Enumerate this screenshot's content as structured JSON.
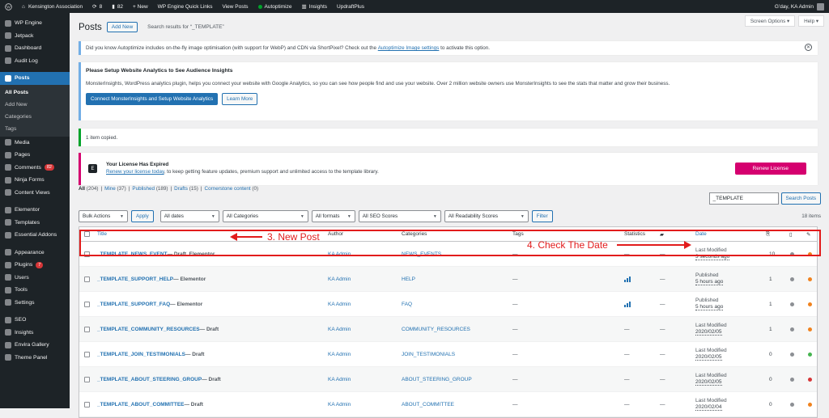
{
  "admin_bar": {
    "site_name": "Kensington Association",
    "updates_count": "8",
    "comments_count": "82",
    "new_label": "+ New",
    "items": [
      "WP Engine Quick Links",
      "View Posts",
      "Autoptimize",
      "Insights",
      "UpdraftPlus"
    ],
    "greeting": "G'day, KA Admin"
  },
  "sidebar": {
    "items_top": [
      {
        "label": "WP Engine",
        "icon": "wp-engine-icon"
      },
      {
        "label": "Jetpack",
        "icon": "jetpack-icon"
      },
      {
        "label": "Dashboard",
        "icon": "dashboard-icon"
      },
      {
        "label": "Audit Log",
        "icon": "audit-log-icon"
      }
    ],
    "posts": {
      "label": "Posts",
      "icon": "posts-icon"
    },
    "submenu": [
      "All Posts",
      "Add New",
      "Categories",
      "Tags"
    ],
    "items_mid": [
      {
        "label": "Media",
        "icon": "media-icon"
      },
      {
        "label": "Pages",
        "icon": "pages-icon"
      },
      {
        "label": "Comments",
        "icon": "comments-icon",
        "badge": "82"
      },
      {
        "label": "Ninja Forms",
        "icon": "ninja-forms-icon"
      },
      {
        "label": "Content Views",
        "icon": "content-views-icon"
      }
    ],
    "items_mid2": [
      {
        "label": "Elementor",
        "icon": "elementor-icon"
      },
      {
        "label": "Templates",
        "icon": "templates-icon"
      },
      {
        "label": "Essential Addons",
        "icon": "essential-addons-icon"
      }
    ],
    "items_low": [
      {
        "label": "Appearance",
        "icon": "appearance-icon"
      },
      {
        "label": "Plugins",
        "icon": "plugins-icon",
        "badge": "7"
      },
      {
        "label": "Users",
        "icon": "users-icon"
      },
      {
        "label": "Tools",
        "icon": "tools-icon"
      },
      {
        "label": "Settings",
        "icon": "settings-icon"
      }
    ],
    "items_bottom": [
      {
        "label": "SEO",
        "icon": "seo-icon"
      },
      {
        "label": "Insights",
        "icon": "insights-icon"
      },
      {
        "label": "Envira Gallery",
        "icon": "envira-gallery-icon"
      },
      {
        "label": "Theme Panel",
        "icon": "theme-panel-icon"
      }
    ]
  },
  "header": {
    "screen_options": "Screen Options ▾",
    "help": "Help ▾",
    "title": "Posts",
    "add_new": "Add New",
    "search_results": "Search results for “_TEMPLATE”"
  },
  "notices": {
    "autoptimize_text": "Did you know Autoptimize includes on-the-fly image optimisation (with support for WebP) and CDN via ShortPixel? Check out the",
    "autoptimize_link": "Autoptimize Image settings",
    "autoptimize_tail": "to activate this option.",
    "analytics_title": "Please Setup Website Analytics to See Audience Insights",
    "analytics_body": "MonsterInsights, WordPress analytics plugin, helps you connect your website with Google Analytics, so you can see how people find and use your website. Over 2 million website owners use MonsterInsights to see the stats that matter and grow their business.",
    "connect_button": "Connect MonsterInsights and Setup Website Analytics",
    "learn_more": "Learn More",
    "copied": "1 item copied.",
    "license_title": "Your License Has Expired",
    "license_link": "Renew your license today",
    "license_tail": ", to keep getting feature updates, premium support and unlimited access to the template library.",
    "renew_button": "Renew License"
  },
  "filters": {
    "views": [
      {
        "label": "All",
        "count": "(204)"
      },
      {
        "label": "Mine",
        "count": "(37)"
      },
      {
        "label": "Published",
        "count": "(189)"
      },
      {
        "label": "Drafts",
        "count": "(15)"
      },
      {
        "label": "Cornerstone content",
        "count": "(0)"
      }
    ],
    "search_value": "_TEMPLATE",
    "search_button": "Search Posts",
    "bulk_actions": "Bulk Actions",
    "apply": "Apply",
    "all_dates": "All dates",
    "all_categories": "All Categories",
    "all_formats": "All formats",
    "all_seo": "All SEO Scores",
    "all_readability": "All Readability Scores",
    "filter": "Filter",
    "items_count": "18 items"
  },
  "table": {
    "headers": {
      "title": "Title",
      "author": "Author",
      "categories": "Categories",
      "tags": "Tags",
      "statistics": "Statistics",
      "date": "Date"
    },
    "rows": [
      {
        "title": "_TEMPLATE_NEWS_EVENT",
        "state": " — Draft, Elementor",
        "author": "KA Admin",
        "category": "NEWS_EVENTS",
        "tags": "—",
        "stats": "—",
        "comments": "—",
        "date_label": "Last Modified",
        "date": "3 seconds ago",
        "count": "10",
        "dot1": "#8c8f94",
        "dot2": "#f0821e",
        "has_stats": false
      },
      {
        "title": "_TEMPLATE_SUPPORT_HELP",
        "state": " — Elementor",
        "author": "KA Admin",
        "category": "HELP",
        "tags": "—",
        "stats": "",
        "comments": "—",
        "date_label": "Published",
        "date": "5 hours ago",
        "count": "1",
        "dot1": "#8c8f94",
        "dot2": "#f0821e",
        "has_stats": true
      },
      {
        "title": "_TEMPLATE_SUPPORT_FAQ",
        "state": " — Elementor",
        "author": "KA Admin",
        "category": "FAQ",
        "tags": "—",
        "stats": "",
        "comments": "—",
        "date_label": "Published",
        "date": "5 hours ago",
        "count": "1",
        "dot1": "#8c8f94",
        "dot2": "#f0821e",
        "has_stats": true
      },
      {
        "title": "_TEMPLATE_COMMUNITY_RESOURCES",
        "state": " — Draft",
        "author": "KA Admin",
        "category": "COMMUNITY_RESOURCES",
        "tags": "—",
        "stats": "—",
        "comments": "—",
        "date_label": "Last Modified",
        "date": "2020/02/05",
        "count": "1",
        "dot1": "#8c8f94",
        "dot2": "#f0821e",
        "has_stats": false
      },
      {
        "title": "_TEMPLATE_JOIN_TESTIMONIALS",
        "state": " — Draft",
        "author": "KA Admin",
        "category": "JOIN_TESTIMONIALS",
        "tags": "—",
        "stats": "—",
        "comments": "—",
        "date_label": "Last Modified",
        "date": "2020/02/05",
        "count": "0",
        "dot1": "#8c8f94",
        "dot2": "#46b450",
        "has_stats": false
      },
      {
        "title": "_TEMPLATE_ABOUT_STEERING_GROUP",
        "state": " — Draft",
        "author": "KA Admin",
        "category": "ABOUT_STEERING_GROUP",
        "tags": "—",
        "stats": "—",
        "comments": "—",
        "date_label": "Last Modified",
        "date": "2020/02/05",
        "count": "0",
        "dot1": "#8c8f94",
        "dot2": "#d63638",
        "has_stats": false
      },
      {
        "title": "_TEMPLATE_ABOUT_COMMITTEE",
        "state": " — Draft",
        "author": "KA Admin",
        "category": "ABOUT_COMMITTEE",
        "tags": "—",
        "stats": "—",
        "comments": "—",
        "date_label": "Last Modified",
        "date": "2020/02/04",
        "count": "0",
        "dot1": "#8c8f94",
        "dot2": "#f0821e",
        "has_stats": false
      }
    ]
  },
  "annotations": {
    "new_post": "3. New Post",
    "check_date": "4. Check The Date"
  }
}
